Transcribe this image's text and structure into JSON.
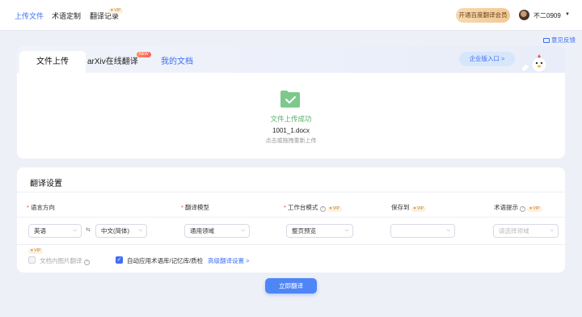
{
  "topnav": {
    "items": [
      {
        "label": "上传文件",
        "active": true
      },
      {
        "label": "术语定制",
        "active": false
      },
      {
        "label": "翻译记录",
        "active": false
      }
    ],
    "record_badge": "♥ VIP",
    "member_button": "开通百度翻译会员",
    "username": "不二0909",
    "feedback": "意见反馈"
  },
  "upload": {
    "tabs": [
      "文件上传",
      "arXiv在线翻译",
      "我的文档"
    ],
    "new_badge": "NEW",
    "enterprise_button": "企业版入口 >",
    "status": "文件上传成功",
    "filename": "1001_1.docx",
    "reupload_hint": "点击或拖拽重新上传"
  },
  "settings": {
    "title": "翻译设置",
    "labels": {
      "lang": "语言方向",
      "model": "翻译模型",
      "mode": "工作台模式",
      "save": "保存到",
      "term": "术语提示"
    },
    "vip_badge": "♥ VIP",
    "values": {
      "source_lang": "英语",
      "target_lang": "中文(简体)",
      "model": "通用领域",
      "mode": "整页预览",
      "save": "",
      "term_placeholder": "请选择领域"
    },
    "options": {
      "image_translate": "文档内图片翻译",
      "auto_apply": "自动应用术语库/记忆库/质检",
      "advanced": "高级翻译设置 >"
    }
  },
  "actions": {
    "translate": "立即翻译"
  },
  "colors": {
    "accent": "#3d6ef5",
    "success": "#58b06a",
    "background": "#eef0f7"
  }
}
